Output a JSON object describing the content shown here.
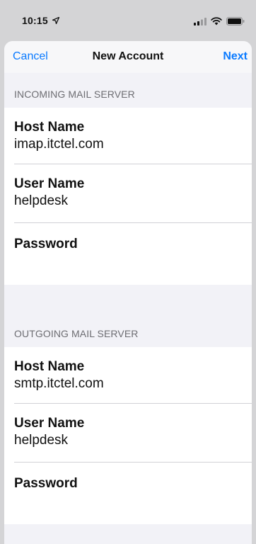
{
  "status_bar": {
    "time": "10:15",
    "location_icon": "location-arrow-icon",
    "signal_icon": "cellular-signal-icon",
    "wifi_icon": "wifi-icon",
    "battery_icon": "battery-icon"
  },
  "nav": {
    "cancel_label": "Cancel",
    "title": "New Account",
    "next_label": "Next"
  },
  "incoming": {
    "header": "INCOMING MAIL SERVER",
    "host_label": "Host Name",
    "host_value": "imap.itctel.com",
    "user_label": "User Name",
    "user_value": "helpdesk",
    "password_label": "Password"
  },
  "outgoing": {
    "header": "OUTGOING MAIL SERVER",
    "host_label": "Host Name",
    "host_value": "smtp.itctel.com",
    "user_label": "User Name",
    "user_value": "helpdesk",
    "password_label": "Password"
  },
  "colors": {
    "accent": "#0a7aff",
    "background": "#f2f2f7",
    "status_bar": "#d4d4d6"
  }
}
